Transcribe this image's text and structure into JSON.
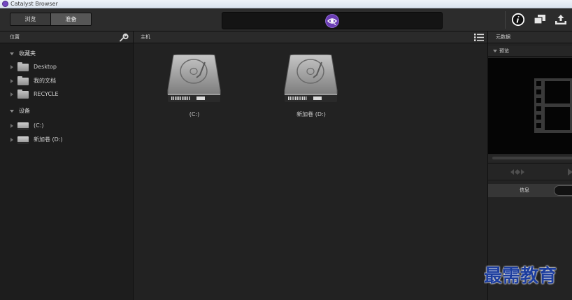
{
  "window": {
    "title": "Catalyst Browser",
    "app_icon": "catalyst-app-icon"
  },
  "toolbar": {
    "modes": [
      {
        "label": "浏览",
        "selected": false
      },
      {
        "label": "准备",
        "selected": true
      }
    ],
    "center_logo": "catalyst-logo-icon",
    "actions": [
      {
        "icon": "info-icon"
      },
      {
        "icon": "window-stack-icon"
      },
      {
        "icon": "export-icon"
      }
    ]
  },
  "sidebar": {
    "title": "位置",
    "settings_icon": "wrench-icon",
    "sections": [
      {
        "label": "收藏夹",
        "expanded": true,
        "items": [
          {
            "label": "Desktop",
            "icon": "folder-icon"
          },
          {
            "label": "我的文档",
            "icon": "folder-icon"
          },
          {
            "label": "RECYCLE",
            "icon": "folder-icon"
          }
        ]
      },
      {
        "label": "设备",
        "expanded": true,
        "items": [
          {
            "label": "(C:)",
            "icon": "drive-icon"
          },
          {
            "label": "新加卷 (D:)",
            "icon": "drive-icon"
          }
        ]
      }
    ]
  },
  "browser": {
    "title": "主机",
    "view_toggle_icon": "list-view-icon",
    "items": [
      {
        "label": "(C:)",
        "icon": "hard-drive-icon"
      },
      {
        "label": "新加卷 (D:)",
        "icon": "hard-drive-icon"
      }
    ]
  },
  "inspector": {
    "title": "元数据",
    "preview": {
      "label": "预览",
      "placeholder_icon": "film-strip-icon",
      "scrub_position": 0
    },
    "tabs": [
      {
        "label": "信息",
        "selected": false
      },
      {
        "selected": true
      }
    ]
  },
  "watermark": {
    "text": "最需教育"
  },
  "colors": {
    "accent": "#6a3db3",
    "watermark": "#1c3d9e",
    "background": "#1f1f1f"
  }
}
